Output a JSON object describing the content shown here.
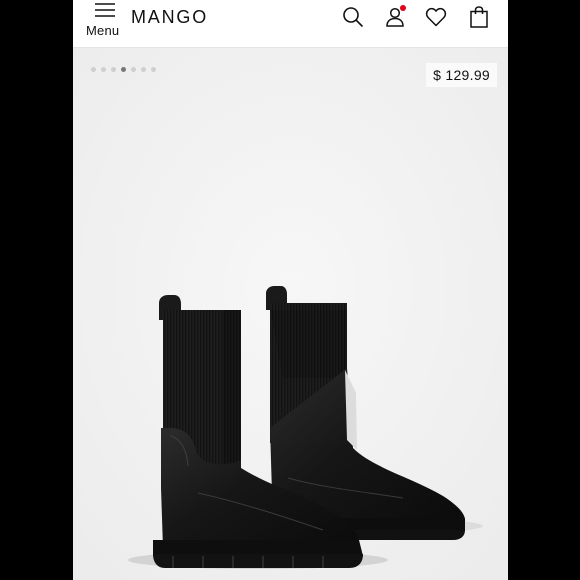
{
  "header": {
    "menu_label": "Menu",
    "logo": "MANGO",
    "icons": [
      "search-icon",
      "account-icon",
      "wishlist-heart-icon",
      "shopping-bag-icon"
    ],
    "notification_dot_color": "#e3001b"
  },
  "gallery": {
    "dot_count": 7,
    "active_index": 3
  },
  "product": {
    "price": "$ 129.99",
    "image": "black-chelsea-boots-with-knit-shaft"
  }
}
